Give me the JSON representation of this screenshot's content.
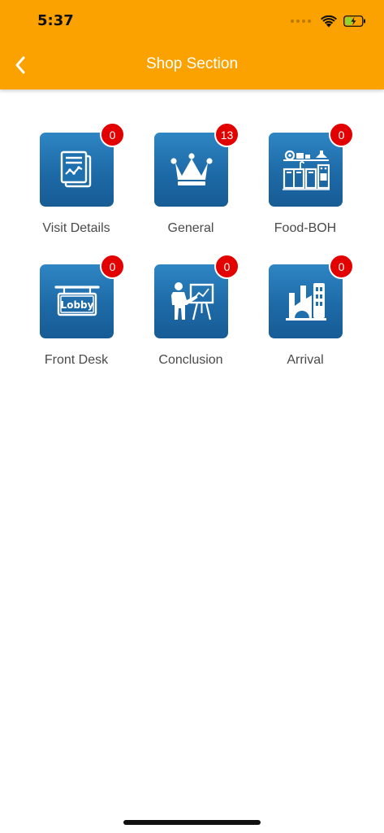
{
  "status_bar": {
    "time": "5:37",
    "icons": [
      "signal-dots-icon",
      "wifi-icon",
      "battery-charging-icon"
    ]
  },
  "nav": {
    "title": "Shop Section",
    "back_icon": "chevron-left-icon"
  },
  "colors": {
    "header_bg": "#FBA200",
    "tile_bg": "#1F6FAE",
    "badge_bg": "#E30000",
    "label_text": "#4A4A4A",
    "battery_fill": "#8CD62F"
  },
  "battery_level": 0.4,
  "sections": [
    {
      "label": "Visit Details",
      "badge": "0",
      "icon": "report-chart-icon"
    },
    {
      "label": "General",
      "badge": "13",
      "icon": "crown-icon"
    },
    {
      "label": "Food-BOH",
      "badge": "0",
      "icon": "kitchen-icon"
    },
    {
      "label": "Front Desk",
      "badge": "0",
      "icon": "lobby-sign-icon",
      "icon_text": "Lobby"
    },
    {
      "label": "Conclusion",
      "badge": "0",
      "icon": "presenter-icon"
    },
    {
      "label": "Arrival",
      "badge": "0",
      "icon": "building-icon"
    }
  ]
}
